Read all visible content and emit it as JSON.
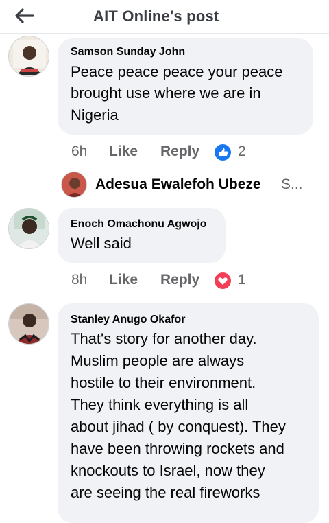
{
  "header": {
    "title": "AIT Online's post"
  },
  "comments": [
    {
      "author": "Samson Sunday John",
      "lines": [
        "Peace peace peace your peace",
        "brought use where we are in",
        "Nigeria"
      ],
      "time": "6h",
      "like": "Like",
      "reply": "Reply",
      "reaction": "like-icon",
      "reaction_count": "2"
    },
    {
      "author": "Enoch Omachonu Agwojo",
      "lines": [
        "Well said"
      ],
      "time": "8h",
      "like": "Like",
      "reply": "Reply",
      "reaction": "love-icon",
      "reaction_count": "1"
    },
    {
      "author": "Stanley Anugo Okafor",
      "lines": [
        "That's story for another day.",
        "Muslim people are always",
        "hostile to their environment.",
        "They think everything is all",
        "about jihad ( by conquest). They",
        "have been throwing rockets and",
        "knockouts to Israel, now they",
        "are seeing the real fireworks"
      ]
    }
  ],
  "reply_preview": {
    "author": "Adesua Ewalefoh Ubeze",
    "snippet": "S..."
  },
  "colors": {
    "like_blue": "#1877f2",
    "love_red": "#f33e58",
    "bubble": "#f0f2f5",
    "meta_gray": "#65676b"
  }
}
